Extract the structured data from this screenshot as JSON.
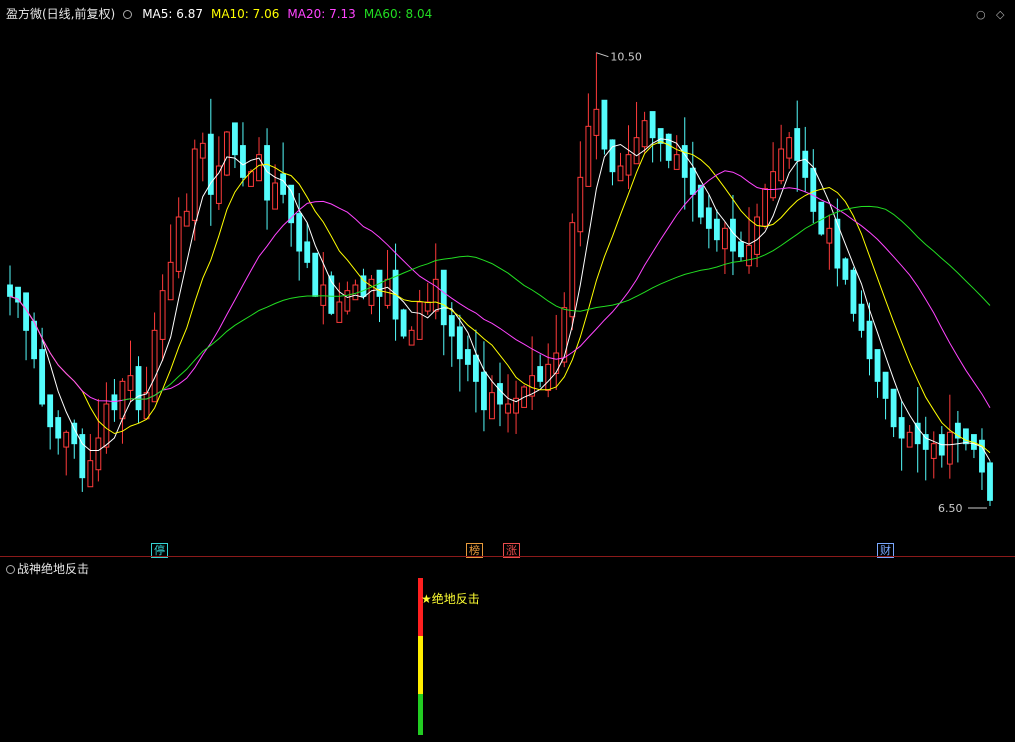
{
  "header": {
    "title": "盈方微(日线,前复权)",
    "ma5": "MA5: 6.87",
    "ma10": "MA10: 7.06",
    "ma20": "MA20: 7.13",
    "ma60": "MA60: 8.04",
    "colors": {
      "ma5": "#ffffff",
      "ma10": "#ffff00",
      "ma20": "#ff44ff",
      "ma60": "#22dd22"
    }
  },
  "annotations": {
    "high_label": "10.50",
    "low_label": "6.50"
  },
  "markers": [
    {
      "label": "停",
      "color": "#35d4d4"
    },
    {
      "label": "榜",
      "color": "#e89a3c"
    },
    {
      "label": "涨",
      "color": "#e84c4c"
    },
    {
      "label": "财",
      "color": "#7aa8ff"
    }
  ],
  "sub_panel": {
    "title": "战神绝地反击",
    "signal_label": "★绝地反击",
    "bar_colors": [
      "#ff2020",
      "#ffee00",
      "#22cc22"
    ]
  },
  "chart_data": {
    "type": "candlestick",
    "y_range": [
      6.2,
      10.7
    ],
    "highest": 10.5,
    "lowest": 6.5,
    "close": [
      8.35,
      8.3,
      8.05,
      7.8,
      7.4,
      7.2,
      7.1,
      7.15,
      7.05,
      6.75,
      6.9,
      7.1,
      7.4,
      7.35,
      7.6,
      7.65,
      7.35,
      7.5,
      8.05,
      8.4,
      8.65,
      9.05,
      9.1,
      9.65,
      9.7,
      9.25,
      9.5,
      9.8,
      9.6,
      9.4,
      9.45,
      9.6,
      9.2,
      9.35,
      9.25,
      9.0,
      8.75,
      8.65,
      8.35,
      8.45,
      8.2,
      8.3,
      8.4,
      8.45,
      8.35,
      8.5,
      8.35,
      8.5,
      8.15,
      8.0,
      8.05,
      8.3,
      8.3,
      8.5,
      8.1,
      8.0,
      7.8,
      7.75,
      7.6,
      7.35,
      7.5,
      7.4,
      7.4,
      7.45,
      7.55,
      7.65,
      7.6,
      7.75,
      7.85,
      8.25,
      9.0,
      9.4,
      9.85,
      10.0,
      9.65,
      9.45,
      9.5,
      9.6,
      9.75,
      9.9,
      9.75,
      9.7,
      9.55,
      9.6,
      9.4,
      9.25,
      9.05,
      8.95,
      8.85,
      8.95,
      8.75,
      8.7,
      8.8,
      9.05,
      9.3,
      9.45,
      9.65,
      9.75,
      9.55,
      9.4,
      9.1,
      8.9,
      8.95,
      8.6,
      8.5,
      8.2,
      8.05,
      7.8,
      7.6,
      7.45,
      7.2,
      7.1,
      7.15,
      7.05,
      7.0,
      7.05,
      6.95,
      7.15,
      7.1,
      7.05,
      7.0,
      6.8,
      6.55
    ]
  }
}
